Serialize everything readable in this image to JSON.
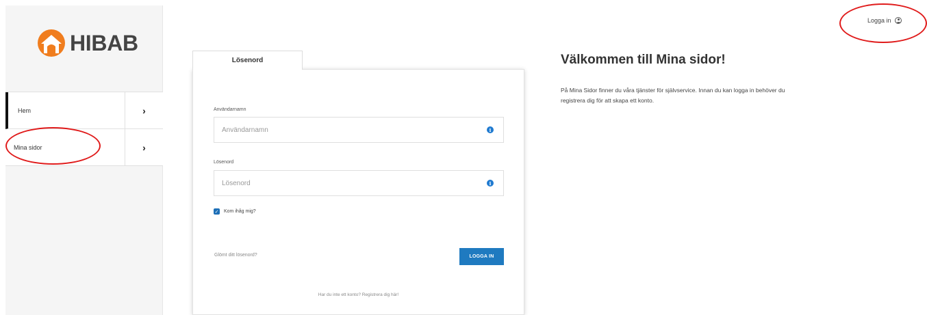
{
  "brand": {
    "logo_text": "HIBAB",
    "logo_color": "#f07d1e"
  },
  "sidebar": {
    "items": [
      {
        "label": "Hem",
        "active": true
      },
      {
        "label": "Mina sidor",
        "active": false
      }
    ]
  },
  "login": {
    "tab_label": "Lösenord",
    "username_label": "Användarnamn",
    "username_placeholder": "Användarnamn",
    "password_label": "Lösenord",
    "password_placeholder": "Lösenord",
    "remember_label": "Kom ihåg mig?",
    "remember_checked": true,
    "forgot_link": "Glömt ditt lösenord?",
    "submit_label": "LOGGA IN",
    "register_text": "Har du inte ett konto? Registrera dig här!"
  },
  "welcome": {
    "title": "Välkommen till Mina sidor!",
    "text": "På Mina Sidor finner du våra tjänster för självservice. Innan du kan logga in behöver du registrera dig för att skapa ett konto."
  },
  "topbar": {
    "login_label": "Logga in"
  },
  "colors": {
    "primary": "#1f7ac0",
    "annotation": "#e01b1b",
    "brand_orange": "#f07d1e"
  }
}
